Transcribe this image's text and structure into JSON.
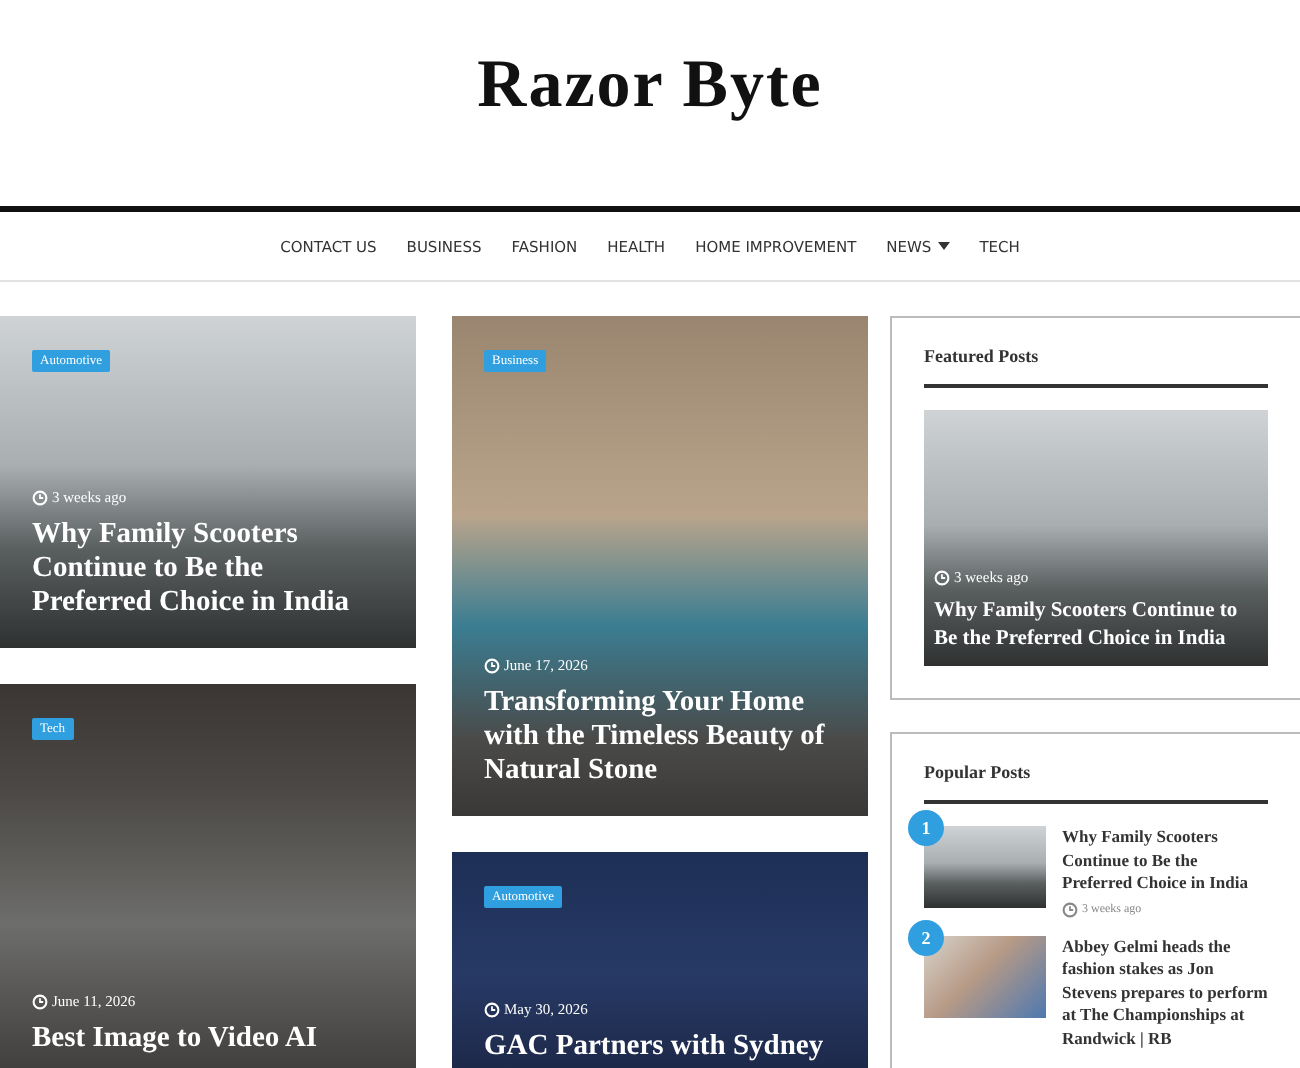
{
  "site_title": "Razor Byte",
  "nav": [
    {
      "label": "CONTACT US",
      "dropdown": false
    },
    {
      "label": "BUSINESS",
      "dropdown": false
    },
    {
      "label": "FASHION",
      "dropdown": false
    },
    {
      "label": "HEALTH",
      "dropdown": false
    },
    {
      "label": "HOME IMPROVEMENT",
      "dropdown": false
    },
    {
      "label": "NEWS",
      "dropdown": true
    },
    {
      "label": "TECH",
      "dropdown": false
    }
  ],
  "columns": [
    [
      {
        "category": "Automotive",
        "date": "3 weeks ago",
        "title": "Why Family Scooters Continue to Be the Preferred Choice in India"
      },
      {
        "category": "Tech",
        "date": "June 11, 2026",
        "title": "Best Image to Video AI"
      }
    ],
    [
      {
        "category": "Business",
        "date": "June 17, 2026",
        "title": "Transforming Your Home with the Timeless Beauty of Natural Stone"
      },
      {
        "category": "Automotive",
        "date": "May 30, 2026",
        "title": "GAC Partners with Sydney"
      }
    ]
  ],
  "featured": {
    "heading": "Featured Posts",
    "date": "3 weeks ago",
    "title": "Why Family Scooters Continue to Be the Preferred Choice in India"
  },
  "popular": {
    "heading": "Popular Posts",
    "items": [
      {
        "rank": "1",
        "title": "Why Family Scooters Continue to Be the Preferred Choice in India",
        "date": "3 weeks ago"
      },
      {
        "rank": "2",
        "title": "Abbey Gelmi heads the fashion stakes as Jon Stevens prepares to perform at The Championships at Randwick | RB"
      }
    ]
  }
}
